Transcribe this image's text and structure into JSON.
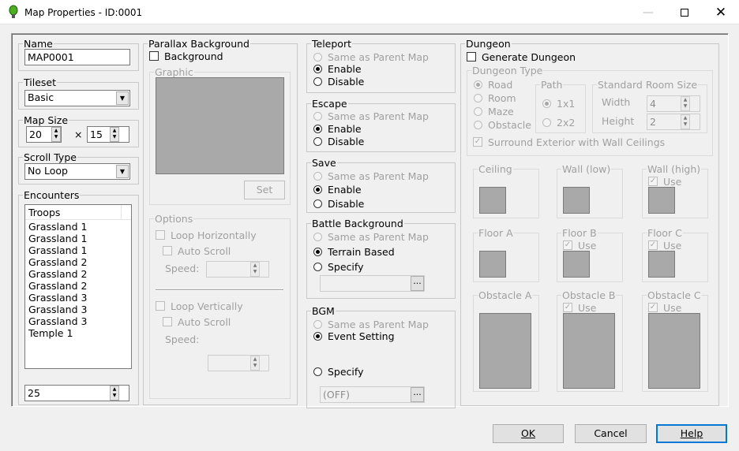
{
  "window": {
    "title": "Map Properties - ID:0001",
    "min_icon": "minimize-icon",
    "max_icon": "maximize-icon",
    "close_icon": "close-icon"
  },
  "name": {
    "legend": "Name",
    "value": "MAP0001"
  },
  "tileset": {
    "legend": "Tileset",
    "value": "Basic"
  },
  "map_size": {
    "legend": "Map Size",
    "width": "20",
    "times": "×",
    "height": "15"
  },
  "scroll_type": {
    "legend": "Scroll Type",
    "value": "No Loop"
  },
  "encounters": {
    "legend": "Encounters",
    "column": "Troops",
    "troops": [
      "Grassland 1",
      "Grassland 1",
      "Grassland 1",
      "Grassland 2",
      "Grassland 2",
      "Grassland 2",
      "Grassland 3",
      "Grassland 3",
      "Grassland 3",
      "Temple 1"
    ],
    "steps": "25"
  },
  "parallax": {
    "legend": "Parallax Background",
    "background_label": "Background",
    "graphic_legend": "Graphic",
    "set_label": "Set",
    "options_legend": "Options",
    "loop_h": "Loop Horizontally",
    "auto_scroll_h": "Auto Scroll",
    "speed_h": "Speed:",
    "loop_v": "Loop Vertically",
    "auto_scroll_v": "Auto Scroll",
    "speed_v": "Speed:"
  },
  "teleport": {
    "legend": "Teleport",
    "opt1": "Same as Parent Map",
    "opt2": "Enable",
    "opt3": "Disable"
  },
  "escape": {
    "legend": "Escape",
    "opt1": "Same as Parent Map",
    "opt2": "Enable",
    "opt3": "Disable"
  },
  "save": {
    "legend": "Save",
    "opt1": "Same as Parent Map",
    "opt2": "Enable",
    "opt3": "Disable"
  },
  "battle_bg": {
    "legend": "Battle Background",
    "opt1": "Same as Parent Map",
    "opt2": "Terrain Based",
    "opt3": "Specify",
    "browse": "..."
  },
  "bgm": {
    "legend": "BGM",
    "opt1": "Same as Parent Map",
    "opt2": "Event Setting",
    "opt3": "Specify",
    "value": "(OFF)",
    "browse": "..."
  },
  "dungeon": {
    "legend": "Dungeon",
    "generate": "Generate Dungeon",
    "type_legend": "Dungeon Type",
    "road": "Road",
    "room": "Room",
    "maze": "Maze",
    "obstacle": "Obstacle",
    "path_legend": "Path",
    "path1": "1x1",
    "path2": "2x2",
    "room_size_legend": "Standard Room Size",
    "width_label": "Width",
    "width_value": "4",
    "height_label": "Height",
    "height_value": "2",
    "surround": "Surround Exterior with Wall Ceilings",
    "ceiling": "Ceiling",
    "wall_low": "Wall (low)",
    "wall_high": "Wall (high)",
    "floor_a": "Floor A",
    "floor_b": "Floor B",
    "floor_c": "Floor C",
    "obstacle_a": "Obstacle A",
    "obstacle_b": "Obstacle B",
    "obstacle_c": "Obstacle C",
    "use": "Use"
  },
  "buttons": {
    "ok": "OK",
    "cancel": "Cancel",
    "help": "Help"
  }
}
